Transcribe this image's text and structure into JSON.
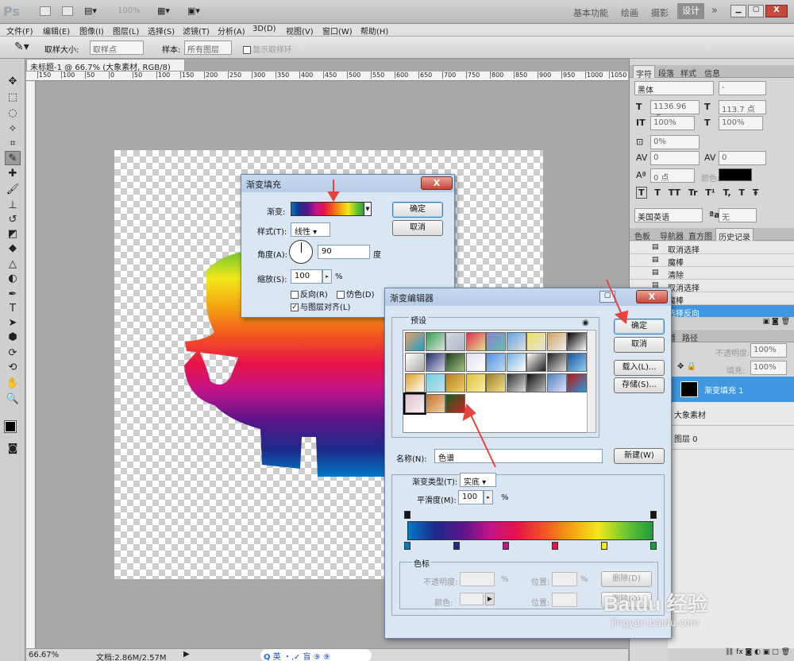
{
  "app": {
    "logo": "Ps",
    "zoom": "100%",
    "workspaces": [
      "基本功能",
      "绘画",
      "摄影",
      "设计"
    ],
    "active_workspace": "设计",
    "more": "»"
  },
  "menu": [
    "文件(F)",
    "编辑(E)",
    "图像(I)",
    "图层(L)",
    "选择(S)",
    "滤镜(T)",
    "分析(A)",
    "3D(D)",
    "视图(V)",
    "窗口(W)",
    "帮助(H)"
  ],
  "options": {
    "size_label": "取样大小:",
    "size_value": "取样点",
    "sample_label": "样本:",
    "sample_value": "所有图层",
    "ring_label": "显示取样环"
  },
  "doc_tab": "未标题-1 @ 66.7% (大象素材, RGB/8) *",
  "ruler_ticks": [
    "150",
    "100",
    "50",
    "0",
    "50",
    "100",
    "150",
    "200",
    "250",
    "300",
    "350",
    "400",
    "450",
    "500",
    "550",
    "600",
    "650",
    "700",
    "750",
    "800",
    "850",
    "900",
    "950",
    "1000",
    "1050"
  ],
  "status": {
    "zoom": "66.67%",
    "doc": "文档:2.86M/2.57M"
  },
  "taskbar": "英 ・,✓ 盲 ⑨ ⑨",
  "watermark": {
    "brand": "Baidu 经验",
    "url": "jingyan.baidu.com"
  },
  "char_panel": {
    "tabs": [
      "字符",
      "段落",
      "样式",
      "信息"
    ],
    "font": "黑体",
    "style": "-",
    "size": "1136.96 点",
    "leading": "113.7 点",
    "vscale": "100%",
    "hscale": "100%",
    "tracking_pct": "0%",
    "kerning": "0",
    "tracking": "0",
    "baseline": "0 点",
    "color_label": "颜色:",
    "styles": [
      "T",
      "T",
      "TT",
      "Tr",
      "T¹",
      "T,",
      "T",
      "Ŧ"
    ],
    "lang": "美国英语",
    "aa_label": "ªa",
    "aa": "无"
  },
  "history_panel": {
    "tabs": [
      "色板",
      "导航器",
      "直方图",
      "历史记录"
    ],
    "items": [
      "取消选择",
      "魔棒",
      "清除",
      "取消选择",
      "魔棒",
      "选择反向"
    ]
  },
  "layers_panel": {
    "tabs": [
      "图层",
      "通道",
      "路径"
    ],
    "opacity_label": "不透明度:",
    "opacity": "100%",
    "fill_label": "填充:",
    "fill": "100%",
    "layers": [
      "渐变填充 1",
      "大象素材",
      "图层 0"
    ]
  },
  "gradient_fill": {
    "title": "渐变填充",
    "gradient_label": "渐变:",
    "style_label": "样式(T):",
    "style": "线性",
    "angle_label": "角度(A):",
    "angle": "90",
    "degree": "度",
    "scale_label": "缩放(S):",
    "scale": "100",
    "pct": "%",
    "reverse": "反向(R)",
    "dither": "仿色(D)",
    "align": "与图层对齐(L)",
    "ok": "确定",
    "cancel": "取消",
    "close": "X"
  },
  "gradient_editor": {
    "title": "渐变编辑器",
    "presets_label": "预设",
    "ok": "确定",
    "cancel": "取消",
    "load": "载入(L)...",
    "save": "存储(S)...",
    "name_label": "名称(N):",
    "name": "色谱",
    "new": "新建(W)",
    "type_label": "渐变类型(T):",
    "type": "实底",
    "smooth_label": "平滑度(M):",
    "smooth": "100",
    "pct": "%",
    "stops_label": "色标",
    "opacity_label": "不透明度:",
    "position_label": "位置:",
    "delete": "删除(D)",
    "color_label": "颜色:",
    "position_label2": "位置:",
    "delete2": "删除(D)",
    "presets": [
      "#e9a060|#1aa0d0",
      "#30a050|#e0e0e0",
      "#cfd8e2|#aeb8c4",
      "#e03050|#e0e090",
      "#9080d0|#60c0b0",
      "#60a0e0|#e0e0e0",
      "#f0e060|#e0e0e0",
      "#d0a060|#f0f0f0",
      "#000|#fff",
      "#fff|#aaa",
      "#203070|#d0d0e0",
      "#204020|#a0c080",
      "#e0e0f0|#fff",
      "#5090e0|#c0d8f0",
      "#70b0e0|#fff",
      "#fff|#202020",
      "#202020|#e0e0e0",
      "#1a50a0|#90d0f0",
      "#e0a020|#fff",
      "#70d0e0|#c0e0f0",
      "#b08020|#f0d060",
      "#e0c040|#f5f0a0",
      "#a08030|#f0e080",
      "#303030|#ddd",
      "#101010|#bbb",
      "#5080c0|#e0e0ff",
      "#c01010|#20a0e0",
      "#e0c0d0|#f8f0f0",
      "#c07030|#f0d0a0",
      "#106020|#d02020"
    ]
  }
}
